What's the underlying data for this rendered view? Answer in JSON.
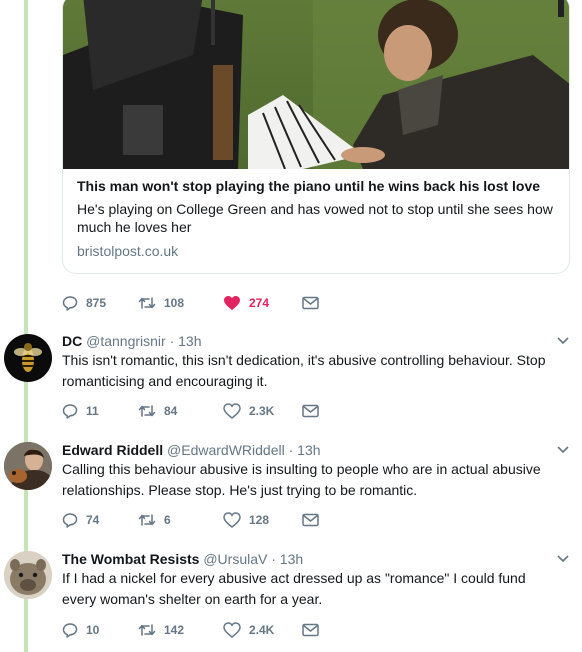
{
  "card": {
    "title": "This man won't stop playing the piano until he wins back his lost love",
    "description": "He's playing on College Green and has vowed not to stop until she sees how much he loves her",
    "domain": "bristolpost.co.uk"
  },
  "main_actions": {
    "replies": "875",
    "retweets": "108",
    "likes": "274",
    "like_color": "#e0245e"
  },
  "replies": [
    {
      "name": "DC",
      "handle": "@tanngrisnir",
      "time": "· 13h",
      "text": "This isn't romantic, this isn't dedication, it's abusive controlling behaviour. Stop romanticising and encouraging it.",
      "replies": "11",
      "retweets": "84",
      "likes": "2.3K",
      "avatar_icon": "bee-avatar-icon"
    },
    {
      "name": "Edward Riddell",
      "handle": "@EdwardWRiddell",
      "time": "· 13h",
      "text": "Calling this behaviour abusive is insulting to people who are in actual abusive relationships. Please stop. He's just trying to be romantic.",
      "replies": "74",
      "retweets": "6",
      "likes": "128",
      "avatar_icon": "person-avatar-icon"
    },
    {
      "name": "The Wombat Resists",
      "handle": "@UrsulaV",
      "time": "· 13h",
      "text": "If I had a nickel for every abusive act dressed up as \"romance\" I could fund every woman's shelter on earth for a year.",
      "replies": "10",
      "retweets": "142",
      "likes": "2.4K",
      "avatar_icon": "wombat-avatar-icon"
    }
  ],
  "colors": {
    "thread_line": "#c4e5b4",
    "muted": "#657786",
    "text": "#14171a"
  }
}
